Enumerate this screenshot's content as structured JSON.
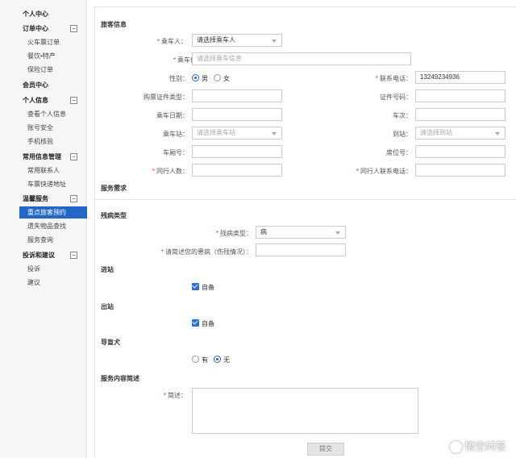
{
  "sidebar": {
    "personal_center": "个人中心",
    "order_center": "订单中心",
    "order_items": [
      "火车票订单",
      "餐饮•特产",
      "保险订单"
    ],
    "member_center": "会员中心",
    "personal_info": "个人信息",
    "personal_items": [
      "查看个人信息",
      "账号安全",
      "手机核验"
    ],
    "common_info": "常用信息管理",
    "common_items": [
      "常用联系人",
      "车票快递地址"
    ],
    "warm_service": "温馨服务",
    "warm_items": [
      "重点旅客预约",
      "遗失物品查找",
      "服务查询"
    ],
    "complaints": "投诉和建议",
    "complaint_items": [
      "投诉",
      "建议"
    ],
    "toggle_symbol": "−"
  },
  "form": {
    "passenger_section": "旅客信息",
    "passenger_label": "乘车人：",
    "passenger_value": "请选择乘车人",
    "passenger_info_label": "乘车信息：",
    "passenger_info_placeholder": "请选择乘车信息",
    "gender_label": "性别：",
    "gender_male": "男",
    "gender_female": "女",
    "phone_label": "联系电话：",
    "phone_value": "13249234936",
    "id_type_label": "购票证件类型：",
    "id_number_label": "证件号码：",
    "date_label": "乘车日期：",
    "train_label": "车次：",
    "from_label": "乘车站：",
    "from_placeholder": "请选择乘车站",
    "to_label": "到站：",
    "to_placeholder": "请选择到站",
    "car_label": "车厢号：",
    "seat_label": "席位号：",
    "companions_label": "同行人数：",
    "companion_phone_label": "同行人联系电话：",
    "service_section": "服务需求",
    "disability_section": "残病类型",
    "disability_type_label": "残病类型：",
    "disability_type_value": "病",
    "illness_desc_label": "请简述您的患病（伤残情况）：",
    "entry_section": "进站",
    "entry_option": "自备",
    "exit_section": "出站",
    "exit_option": "自备",
    "guide_dog_section": "导盲犬",
    "guide_dog_yes": "有",
    "guide_dog_no": "无",
    "service_desc_section": "服务内容简述",
    "summary_label": "简述：",
    "submit_label": "提交",
    "required_mark": "*"
  },
  "watermark": "悟空问答"
}
